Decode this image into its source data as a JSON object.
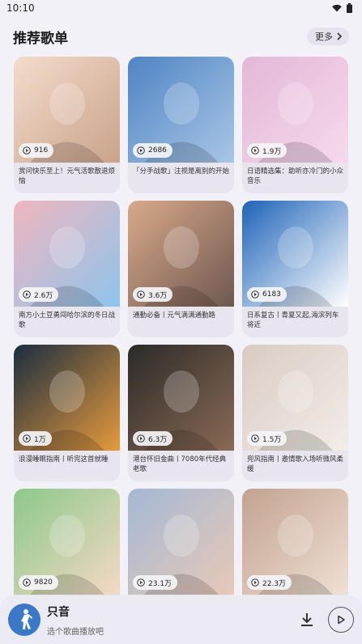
{
  "status_bar": {
    "time": "10:10"
  },
  "header": {
    "title": "推荐歌单",
    "more_label": "更多"
  },
  "playlists": [
    {
      "plays": "916",
      "title": "赏问快乐至上！元气活歌散退烦恼",
      "cover_colors": [
        "#f3dccc",
        "#caa38a"
      ]
    },
    {
      "plays": "2686",
      "title": "「分手战歌」注视是离别的开始",
      "cover_colors": [
        "#4f84c4",
        "#a9c6e6"
      ]
    },
    {
      "plays": "1.9万",
      "title": "日语精选集：助听亦冷门的小众音乐",
      "cover_colors": [
        "#e3b8d8",
        "#f6d9ec"
      ]
    },
    {
      "plays": "2.6万",
      "title": "南方小土豆勇闯哈尔滨的冬日战歌",
      "cover_colors": [
        "#f0b6bf",
        "#8ec4ec"
      ]
    },
    {
      "plays": "3.6万",
      "title": "通勤必备丨元气满满通勤路",
      "cover_colors": [
        "#d9a98a",
        "#6f5850"
      ]
    },
    {
      "plays": "6183",
      "title": "日系复古丨青夏又起,海滨列车将近",
      "cover_colors": [
        "#1e63b8",
        "#ffffff"
      ]
    },
    {
      "plays": "1万",
      "title": "浪漫睡眠指南丨听完这首就睡",
      "cover_colors": [
        "#1b2d40",
        "#e69a3c"
      ]
    },
    {
      "plays": "6.3万",
      "title": "港台怀旧金曲丨7080年代经典老歌",
      "cover_colors": [
        "#2b2a28",
        "#8a6a55"
      ]
    },
    {
      "plays": "1.5万",
      "title": "兜风指南丨邀情歌入场听微风柔缓",
      "cover_colors": [
        "#d9cbc2",
        "#f3ede8"
      ]
    },
    {
      "plays": "9820",
      "title": "",
      "cover_colors": [
        "#8cc88a",
        "#f4d9c4"
      ]
    },
    {
      "plays": "23.1万",
      "title": "",
      "cover_colors": [
        "#a4b8d4",
        "#e8c9b8"
      ]
    },
    {
      "plays": "22.3万",
      "title": "",
      "cover_colors": [
        "#c2a290",
        "#efe0d4"
      ]
    }
  ],
  "player": {
    "app_name": "只音",
    "hint": "选个歌曲播放吧"
  },
  "icons": {
    "wifi": "wifi-icon",
    "battery": "battery-icon",
    "chevron": "chevron-right-icon",
    "play": "play-circle-icon",
    "download": "download-icon",
    "play_button": "play-icon"
  }
}
